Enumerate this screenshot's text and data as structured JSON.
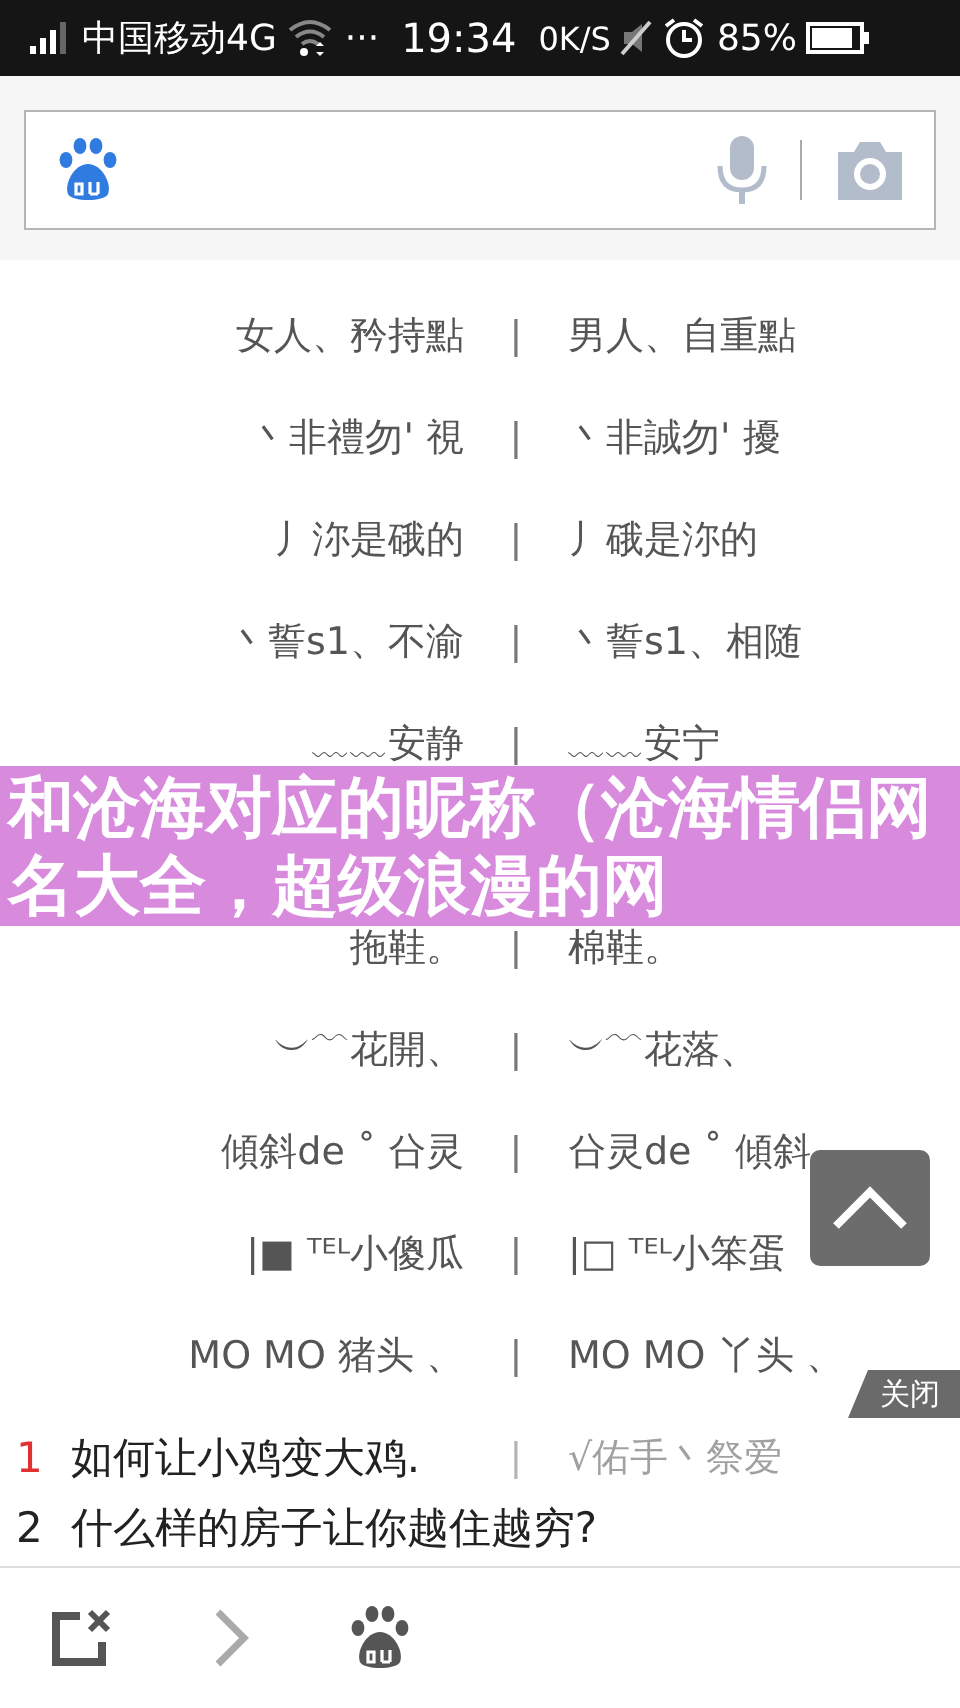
{
  "status_bar": {
    "carrier": "中国移动4G",
    "more": "···",
    "time": "19:34",
    "speed": "0K/S",
    "battery": "85%"
  },
  "search": {
    "kind": "field"
  },
  "nickname_table": {
    "separator": "|",
    "entries_top": [
      {
        "left": "女人、矜持點",
        "right": "男人、自重點"
      },
      {
        "left": "丶非禮勿' 視",
        "right": "丶非誠勿' 擾"
      },
      {
        "left": "丿沵是硪的",
        "right": "丿硪是沵的"
      },
      {
        "left": "丶誓s1、不渝",
        "right": "丶誓s1、相随"
      },
      {
        "left": "﹏﹏安静",
        "right": "﹏﹏安宁"
      }
    ],
    "entries_bottom": [
      {
        "left": "拖鞋。",
        "right": "棉鞋。"
      },
      {
        "left": "︶﹋花開、",
        "right": "︶﹋花落、"
      },
      {
        "left": "傾斜de ˚ 㕣灵",
        "right": "㕣灵de ˚ 傾斜"
      },
      {
        "left": "|■ ᵀᴱᴸ小傻瓜",
        "right": "|□ ᵀᴱᴸ小笨蛋"
      },
      {
        "left": "MO MO 猪头 、",
        "right": "MO MO 丫头 、"
      },
      {
        "right": "√佑手丶祭爱"
      }
    ]
  },
  "banner": {
    "title": "和沧海对应的昵称（沧海情侣网名大全，超级浪漫的网"
  },
  "suggestions": {
    "close": "关闭",
    "items": [
      {
        "rank": "1",
        "text": "如何让小鸡变大鸡.",
        "highlight": true
      },
      {
        "rank": "2",
        "text": "什么样的房子让你越住越穷?",
        "highlight": false
      }
    ]
  }
}
